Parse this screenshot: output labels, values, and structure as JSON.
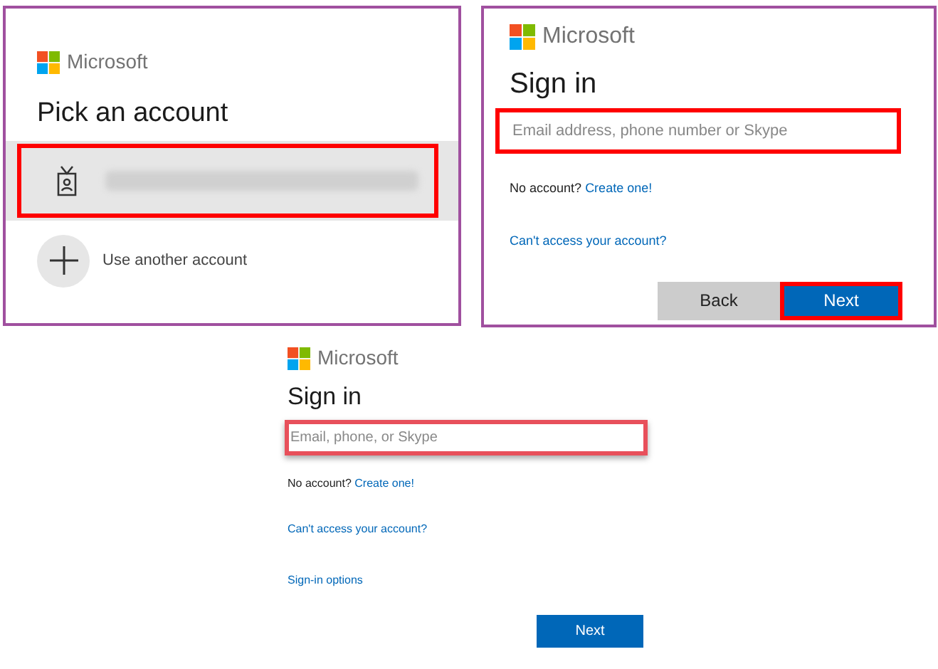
{
  "panels": [
    {
      "kind": "pick",
      "bordered": true,
      "brand": "Microsoft",
      "title": "Pick an account",
      "accounts": [
        {
          "kind": "redacted",
          "highlighted": true
        }
      ],
      "add_account": "Use another account"
    },
    {
      "kind": "signin",
      "bordered": true,
      "brand": "Microsoft",
      "title": "Sign in",
      "email": {
        "placeholder": "Email address, phone number or Skype",
        "highlighted": true
      },
      "no_account": "No account?",
      "create": "Create one!",
      "links": [
        "Can't access your account?"
      ],
      "buttons": [
        {
          "label": "Back",
          "kind": "secondary",
          "highlighted": false
        },
        {
          "label": "Next",
          "kind": "primary",
          "highlighted": true
        }
      ]
    },
    {
      "kind": "signin",
      "bordered": false,
      "brand": "Microsoft",
      "title": "Sign in",
      "email": {
        "placeholder": "Email, phone, or Skype",
        "highlighted": true
      },
      "no_account": "No account?",
      "create": "Create one!",
      "links": [
        "Can't access your account?",
        "Sign-in options"
      ],
      "buttons": [
        {
          "label": "Next",
          "kind": "primary",
          "highlighted": false
        }
      ]
    }
  ]
}
